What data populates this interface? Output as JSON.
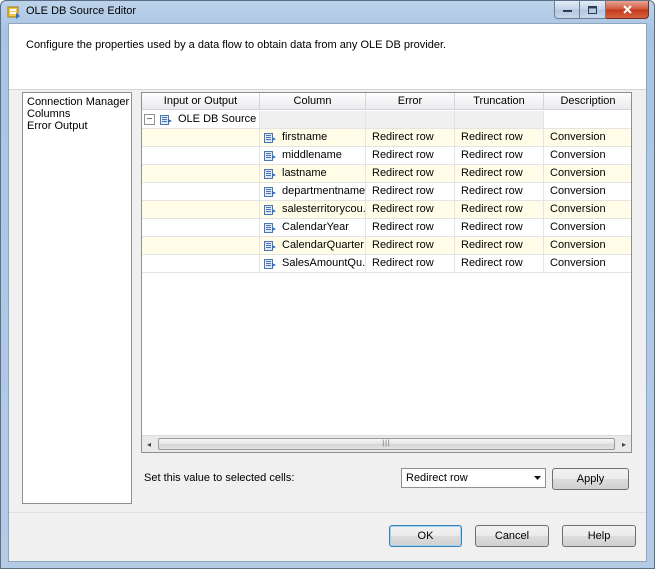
{
  "window": {
    "title": "OLE DB Source Editor",
    "icons": {
      "app": "data-source-icon",
      "minimize": "minimize-icon",
      "maximize": "maximize-icon",
      "close": "close-icon"
    }
  },
  "header": {
    "description": "Configure the properties used by a data flow to obtain data from any OLE DB provider."
  },
  "nav": {
    "items": [
      {
        "label": "Connection Manager"
      },
      {
        "label": "Columns"
      },
      {
        "label": "Error Output"
      }
    ]
  },
  "grid": {
    "headers": [
      "Input or Output",
      "Column",
      "Error",
      "Truncation",
      "Description"
    ],
    "group": {
      "label": "OLE DB Source ...",
      "expander": "−"
    },
    "rows": [
      {
        "column": "firstname",
        "error": "Redirect row",
        "truncation": "Redirect row",
        "description": "Conversion"
      },
      {
        "column": "middlename",
        "error": "Redirect row",
        "truncation": "Redirect row",
        "description": "Conversion"
      },
      {
        "column": "lastname",
        "error": "Redirect row",
        "truncation": "Redirect row",
        "description": "Conversion"
      },
      {
        "column": "departmentname",
        "error": "Redirect row",
        "truncation": "Redirect row",
        "description": "Conversion"
      },
      {
        "column": "salesterritorycou...",
        "error": "Redirect row",
        "truncation": "Redirect row",
        "description": "Conversion"
      },
      {
        "column": "CalendarYear",
        "error": "Redirect row",
        "truncation": "Redirect row",
        "description": "Conversion"
      },
      {
        "column": "CalendarQuarter",
        "error": "Redirect row",
        "truncation": "Redirect row",
        "description": "Conversion"
      },
      {
        "column": "SalesAmountQu...",
        "error": "Redirect row",
        "truncation": "Redirect row",
        "description": "Conversion"
      }
    ],
    "scrollbar": {
      "left_arrow": "◂",
      "right_arrow": "▸",
      "grip": "|||"
    }
  },
  "bulk_set": {
    "label": "Set this value to selected cells:",
    "selected": "Redirect row",
    "apply_label": "Apply"
  },
  "footer": {
    "ok_label": "OK",
    "cancel_label": "Cancel",
    "help_label": "Help"
  }
}
